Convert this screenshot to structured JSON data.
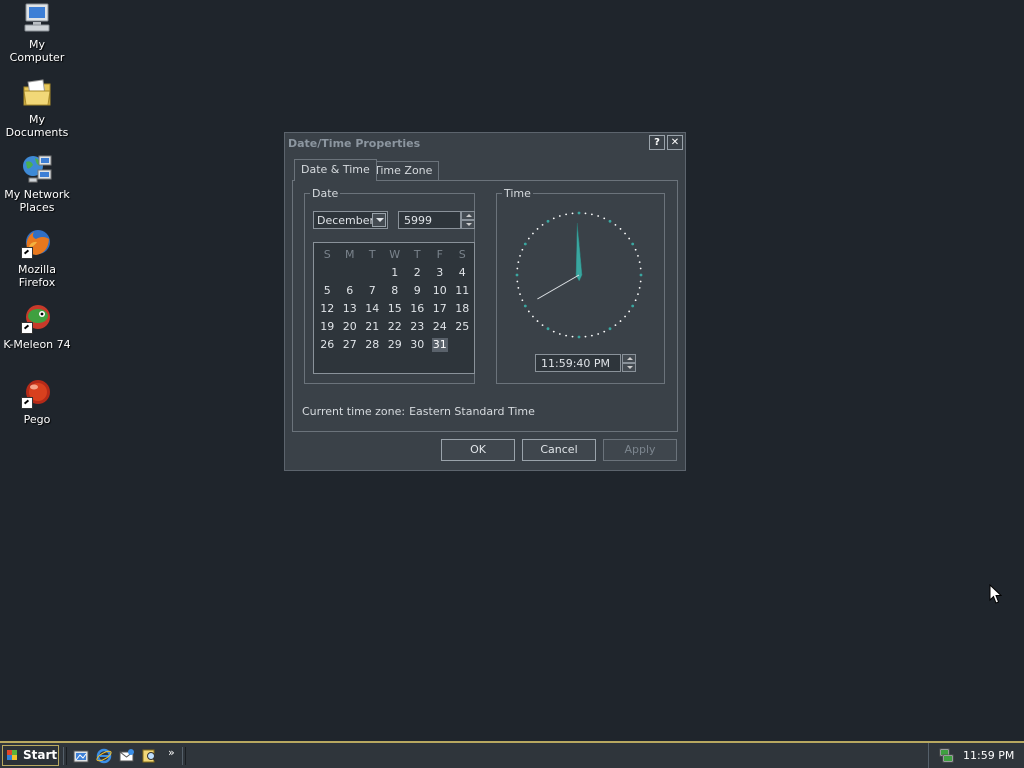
{
  "desktop": {
    "icons": [
      {
        "label": "My Computer",
        "icon": "my-computer-icon"
      },
      {
        "label": "My Documents",
        "icon": "my-documents-icon"
      },
      {
        "label_line1": "My Network",
        "label_line2": "Places",
        "icon": "my-network-places-icon"
      },
      {
        "label": "Mozilla Firefox",
        "icon": "firefox-icon"
      },
      {
        "label": "K-Meleon 74",
        "icon": "k-meleon-icon"
      },
      {
        "label": "Pego",
        "icon": "pego-icon"
      }
    ]
  },
  "dialog": {
    "title": "Date/Time Properties",
    "help_glyph": "?",
    "close_glyph": "✕",
    "tabs": [
      {
        "label": "Date & Time",
        "active": true
      },
      {
        "label": "Time Zone",
        "active": false
      }
    ],
    "date_group_label": "Date",
    "time_group_label": "Time",
    "month": "December",
    "year": "5999",
    "weekdays": [
      "S",
      "M",
      "T",
      "W",
      "T",
      "F",
      "S"
    ],
    "calendar_weeks": [
      [
        "",
        "",
        "",
        "1",
        "2",
        "3",
        "4"
      ],
      [
        "5",
        "6",
        "7",
        "8",
        "9",
        "10",
        "11"
      ],
      [
        "12",
        "13",
        "14",
        "15",
        "16",
        "17",
        "18"
      ],
      [
        "19",
        "20",
        "21",
        "22",
        "23",
        "24",
        "25"
      ],
      [
        "26",
        "27",
        "28",
        "29",
        "30",
        "31",
        ""
      ]
    ],
    "selected_day": "31",
    "time_value": "11:59:40 PM",
    "clock": {
      "hour": 11,
      "minute": 59,
      "second": 40
    },
    "current_tz_label": "Current time zone:",
    "current_tz_value": "Eastern Standard Time",
    "buttons": {
      "ok": "OK",
      "cancel": "Cancel",
      "apply": "Apply"
    },
    "apply_enabled": false
  },
  "taskbar": {
    "start_label": "Start",
    "quick_launch": [
      "show-desktop-icon",
      "internet-explorer-icon",
      "outlook-express-icon",
      "search-icon"
    ],
    "more_glyph": "»",
    "clock": "11:59 PM"
  },
  "colors": {
    "desktop_bg": "#1f252c",
    "dialog_bg": "#3a4148",
    "taskbar_accent": "#b8a860",
    "clock_dots": "#ffffff",
    "clock_hand": "#3aa6a0"
  }
}
